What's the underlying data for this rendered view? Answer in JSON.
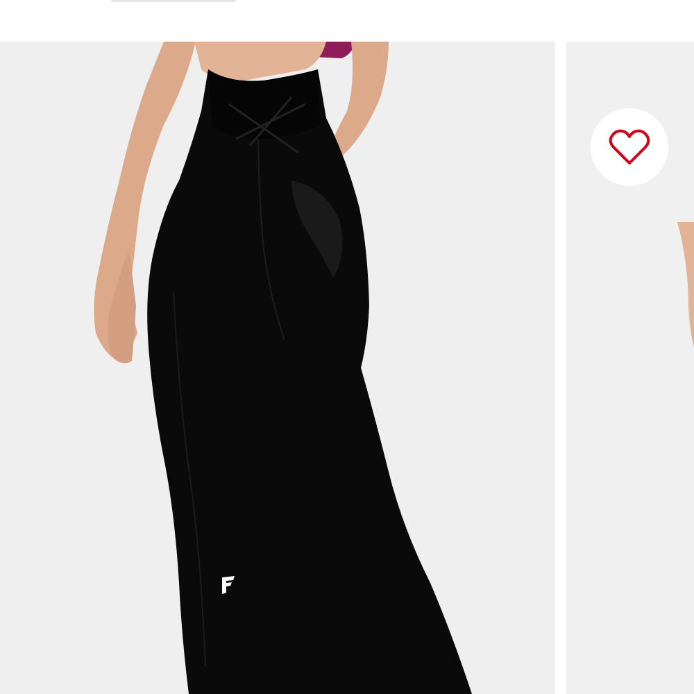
{
  "page": {
    "background": "#ffffff"
  },
  "carousel": {
    "slides": [
      {
        "name": "product-photo-back-view",
        "background": "#efefef"
      },
      {
        "name": "product-photo-next",
        "background": "#f0f0f0"
      }
    ],
    "active_index": 0
  },
  "product": {
    "color": "#0a0a0a",
    "skin": "#e2b394",
    "top_color": "#8e1d5a"
  },
  "wishlist": {
    "icon": "heart-outline-icon",
    "color": "#d0021b",
    "state": "not-favorited"
  },
  "brand_logo": {
    "icon": "brand-f-logo-icon",
    "color": "#ffffff"
  }
}
